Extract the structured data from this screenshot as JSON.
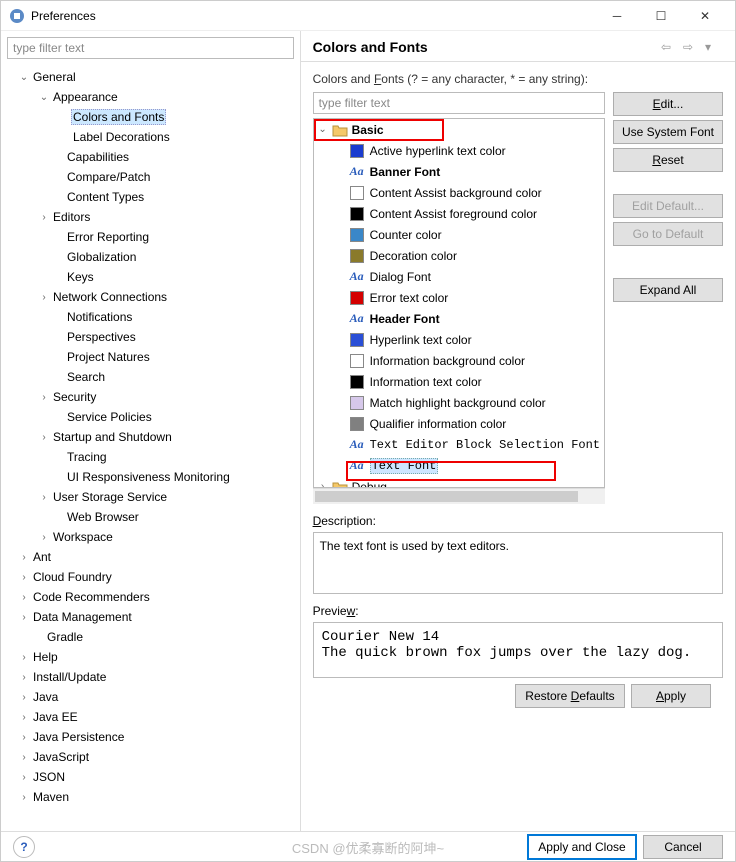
{
  "window": {
    "title": "Preferences"
  },
  "left_filter_placeholder": "type filter text",
  "left_tree": [
    {
      "label": "General",
      "indent": 16,
      "arrow": "v"
    },
    {
      "label": "Appearance",
      "indent": 36,
      "arrow": "v"
    },
    {
      "label": "Colors and Fonts",
      "indent": 56,
      "arrow": "",
      "selected": true
    },
    {
      "label": "Label Decorations",
      "indent": 56,
      "arrow": ""
    },
    {
      "label": "Capabilities",
      "indent": 50,
      "arrow": ""
    },
    {
      "label": "Compare/Patch",
      "indent": 50,
      "arrow": ""
    },
    {
      "label": "Content Types",
      "indent": 50,
      "arrow": ""
    },
    {
      "label": "Editors",
      "indent": 36,
      "arrow": ">"
    },
    {
      "label": "Error Reporting",
      "indent": 50,
      "arrow": ""
    },
    {
      "label": "Globalization",
      "indent": 50,
      "arrow": ""
    },
    {
      "label": "Keys",
      "indent": 50,
      "arrow": ""
    },
    {
      "label": "Network Connections",
      "indent": 36,
      "arrow": ">"
    },
    {
      "label": "Notifications",
      "indent": 50,
      "arrow": ""
    },
    {
      "label": "Perspectives",
      "indent": 50,
      "arrow": ""
    },
    {
      "label": "Project Natures",
      "indent": 50,
      "arrow": ""
    },
    {
      "label": "Search",
      "indent": 50,
      "arrow": ""
    },
    {
      "label": "Security",
      "indent": 36,
      "arrow": ">"
    },
    {
      "label": "Service Policies",
      "indent": 50,
      "arrow": ""
    },
    {
      "label": "Startup and Shutdown",
      "indent": 36,
      "arrow": ">"
    },
    {
      "label": "Tracing",
      "indent": 50,
      "arrow": ""
    },
    {
      "label": "UI Responsiveness Monitoring",
      "indent": 50,
      "arrow": ""
    },
    {
      "label": "User Storage Service",
      "indent": 36,
      "arrow": ">"
    },
    {
      "label": "Web Browser",
      "indent": 50,
      "arrow": ""
    },
    {
      "label": "Workspace",
      "indent": 36,
      "arrow": ">"
    },
    {
      "label": "Ant",
      "indent": 16,
      "arrow": ">"
    },
    {
      "label": "Cloud Foundry",
      "indent": 16,
      "arrow": ">"
    },
    {
      "label": "Code Recommenders",
      "indent": 16,
      "arrow": ">"
    },
    {
      "label": "Data Management",
      "indent": 16,
      "arrow": ">"
    },
    {
      "label": "Gradle",
      "indent": 30,
      "arrow": ""
    },
    {
      "label": "Help",
      "indent": 16,
      "arrow": ">"
    },
    {
      "label": "Install/Update",
      "indent": 16,
      "arrow": ">"
    },
    {
      "label": "Java",
      "indent": 16,
      "arrow": ">"
    },
    {
      "label": "Java EE",
      "indent": 16,
      "arrow": ">"
    },
    {
      "label": "Java Persistence",
      "indent": 16,
      "arrow": ">"
    },
    {
      "label": "JavaScript",
      "indent": 16,
      "arrow": ">"
    },
    {
      "label": "JSON",
      "indent": 16,
      "arrow": ">"
    },
    {
      "label": "Maven",
      "indent": 16,
      "arrow": ">"
    }
  ],
  "right": {
    "title": "Colors and Fonts",
    "hint_prefix": "Colors and ",
    "hint_u": "F",
    "hint_suffix": "onts (? = any character, * = any string):",
    "filter_placeholder": "type filter text",
    "items": [
      {
        "type": "folder",
        "label": "Basic",
        "arrow": "v",
        "indent": 2,
        "bold": true
      },
      {
        "type": "color",
        "label": "Active hyperlink text color",
        "color": "#1a3ccf",
        "indent": 34
      },
      {
        "type": "font",
        "label": "Banner Font",
        "indent": 34,
        "bold": true
      },
      {
        "type": "color",
        "label": "Content Assist background color",
        "color": "#ffffff",
        "indent": 34
      },
      {
        "type": "color",
        "label": "Content Assist foreground color",
        "color": "#000000",
        "indent": 34
      },
      {
        "type": "color",
        "label": "Counter color",
        "color": "#3a87c8",
        "indent": 34
      },
      {
        "type": "color",
        "label": "Decoration color",
        "color": "#8a7a2b",
        "indent": 34
      },
      {
        "type": "font",
        "label": "Dialog Font",
        "indent": 34
      },
      {
        "type": "color",
        "label": "Error text color",
        "color": "#d40000",
        "indent": 34
      },
      {
        "type": "font",
        "label": "Header Font",
        "indent": 34,
        "bold": true
      },
      {
        "type": "color",
        "label": "Hyperlink text color",
        "color": "#2a4fd6",
        "indent": 34
      },
      {
        "type": "color",
        "label": "Information background color",
        "color": "#ffffff",
        "indent": 34
      },
      {
        "type": "color",
        "label": "Information text color",
        "color": "#000000",
        "indent": 34
      },
      {
        "type": "color",
        "label": "Match highlight background color",
        "color": "#d6c8ea",
        "indent": 34
      },
      {
        "type": "color",
        "label": "Qualifier information color",
        "color": "#808080",
        "indent": 34
      },
      {
        "type": "font",
        "label": "Text Editor Block Selection Font",
        "indent": 34,
        "mono": true
      },
      {
        "type": "font",
        "label": "Text Font",
        "indent": 34,
        "mono": true,
        "selected": true
      },
      {
        "type": "folder",
        "label": "Debug",
        "arrow": ">",
        "indent": 2
      }
    ],
    "buttons": {
      "edit": "Edit...",
      "use_system": "Use System Font",
      "reset": "Reset",
      "edit_default": "Edit Default...",
      "go_default": "Go to Default",
      "expand_all": "Expand All"
    },
    "desc_label_u": "D",
    "desc_label_rest": "escription:",
    "description": "The text font is used by text editors.",
    "prev_label_pre": "Previe",
    "prev_label_u": "w",
    "prev_label_post": ":",
    "preview": "Courier New 14\nThe quick brown fox jumps over the lazy dog.",
    "restore_pre": "Restore ",
    "restore_u": "D",
    "restore_post": "efaults",
    "apply_u": "A",
    "apply_post": "pply",
    "apply_close": "Apply and Close",
    "cancel": "Cancel"
  },
  "watermark": "CSDN @优柔寡断的阿坤~"
}
